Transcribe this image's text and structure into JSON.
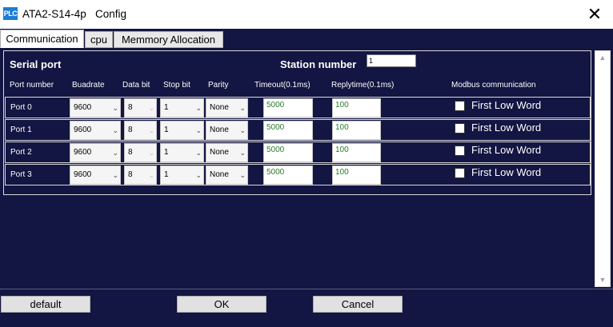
{
  "window": {
    "icon_text": "PLC",
    "title": "ATA2-S14-4p   Config",
    "close_glyph": "✕"
  },
  "tabs": [
    {
      "label": "Communication",
      "active": true
    },
    {
      "label": "cpu",
      "active": false
    },
    {
      "label": "Memmory Allocation",
      "active": false
    }
  ],
  "serial": {
    "section_title": "Serial port",
    "station_label": "Station number",
    "station_value": "1",
    "columns": {
      "port": "Port number",
      "baud": "Buadrate",
      "databit": "Data bit",
      "stopbit": "Stop bit",
      "parity": "Parity",
      "timeout": "Timeout(0.1ms)",
      "reply": "Replytime(0.1ms)",
      "modbus": "Modbus communication"
    },
    "ports": [
      {
        "name": "Port 0",
        "baud": "9600",
        "databit": "8",
        "stopbit": "1",
        "parity": "None",
        "timeout": "5000",
        "reply": "100",
        "modbus_label": "First Low Word"
      },
      {
        "name": "Port 1",
        "baud": "9600",
        "databit": "8",
        "stopbit": "1",
        "parity": "None",
        "timeout": "5000",
        "reply": "100",
        "modbus_label": "First Low Word"
      },
      {
        "name": "Port 2",
        "baud": "9600",
        "databit": "8",
        "stopbit": "1",
        "parity": "None",
        "timeout": "5000",
        "reply": "100",
        "modbus_label": "First Low Word"
      },
      {
        "name": "Port 3",
        "baud": "9600",
        "databit": "8",
        "stopbit": "1",
        "parity": "None",
        "timeout": "5000",
        "reply": "100",
        "modbus_label": "First Low Word"
      }
    ]
  },
  "buttons": {
    "default": "default",
    "ok": "OK",
    "cancel": "Cancel"
  },
  "colors": {
    "background": "#131542",
    "value_text": "#2a7a2a"
  }
}
